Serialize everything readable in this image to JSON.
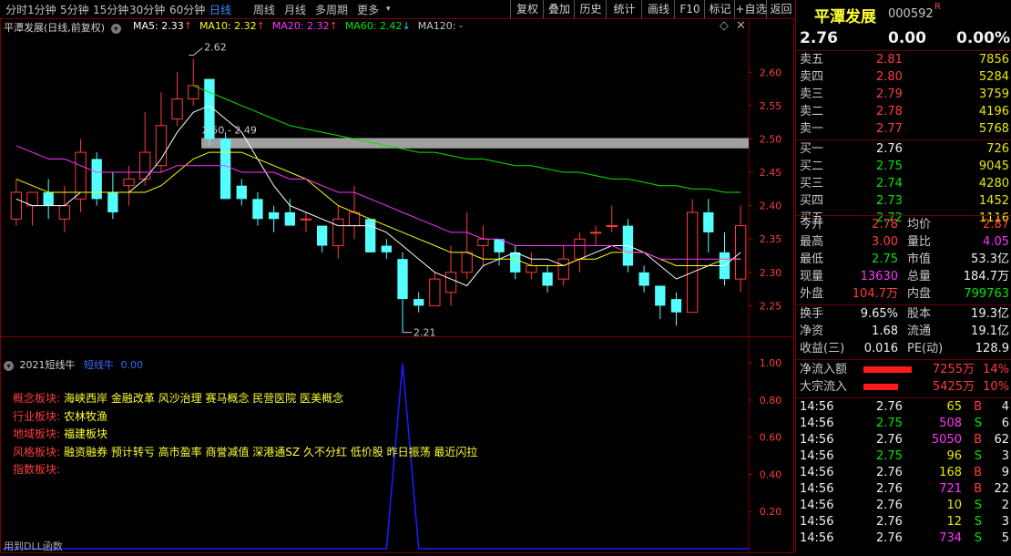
{
  "toolbar": {
    "periods": [
      "分时",
      "1分钟",
      "5分钟",
      "15分钟",
      "30分钟",
      "60分钟",
      "日线",
      "周线",
      "月线",
      "多周期",
      "更多"
    ],
    "active_period": "日线",
    "buttons": [
      "复权",
      "叠加",
      "历史",
      "统计",
      "画线",
      "F10",
      "标记",
      "+自选",
      "返回"
    ]
  },
  "main_chart": {
    "title": "平潭发展(日线,前复权)",
    "ma": [
      {
        "label": "MA5: 2.33",
        "arrow": "↑",
        "color": "#ffffff"
      },
      {
        "label": "MA10: 2.32",
        "arrow": "↑",
        "color": "#ffff00"
      },
      {
        "label": "MA20: 2.32",
        "arrow": "↑",
        "color": "#ff33ff"
      },
      {
        "label": "MA60: 2.42",
        "arrow": "↓",
        "color": "#00e600"
      },
      {
        "label": "MA120: -",
        "arrow": "",
        "color": "#c8c8c8"
      }
    ],
    "annotations": {
      "high": "2.62",
      "low": "2.21",
      "range": "2.50 - 2.49"
    },
    "y_ticks": [
      "2.60",
      "2.55",
      "2.50",
      "2.45",
      "2.40",
      "2.35",
      "2.30",
      "2.25"
    ]
  },
  "chart_data": {
    "type": "candlestick",
    "ylim": [
      2.2,
      2.64
    ],
    "candles": [
      {
        "o": 2.38,
        "h": 2.44,
        "l": 2.37,
        "c": 2.42
      },
      {
        "o": 2.4,
        "h": 2.42,
        "l": 2.37,
        "c": 2.42
      },
      {
        "o": 2.42,
        "h": 2.44,
        "l": 2.38,
        "c": 2.4
      },
      {
        "o": 2.38,
        "h": 2.43,
        "l": 2.36,
        "c": 2.4
      },
      {
        "o": 2.41,
        "h": 2.5,
        "l": 2.39,
        "c": 2.48
      },
      {
        "o": 2.47,
        "h": 2.48,
        "l": 2.4,
        "c": 2.41
      },
      {
        "o": 2.42,
        "h": 2.45,
        "l": 2.38,
        "c": 2.39
      },
      {
        "o": 2.43,
        "h": 2.46,
        "l": 2.4,
        "c": 2.44
      },
      {
        "o": 2.44,
        "h": 2.54,
        "l": 2.43,
        "c": 2.48
      },
      {
        "o": 2.46,
        "h": 2.57,
        "l": 2.45,
        "c": 2.52
      },
      {
        "o": 2.53,
        "h": 2.6,
        "l": 2.52,
        "c": 2.56
      },
      {
        "o": 2.56,
        "h": 2.62,
        "l": 2.55,
        "c": 2.58
      },
      {
        "o": 2.59,
        "h": 2.59,
        "l": 2.49,
        "c": 2.5
      },
      {
        "o": 2.5,
        "h": 2.51,
        "l": 2.41,
        "c": 2.41
      },
      {
        "o": 2.43,
        "h": 2.44,
        "l": 2.4,
        "c": 2.41
      },
      {
        "o": 2.41,
        "h": 2.42,
        "l": 2.37,
        "c": 2.38
      },
      {
        "o": 2.39,
        "h": 2.4,
        "l": 2.36,
        "c": 2.38
      },
      {
        "o": 2.39,
        "h": 2.41,
        "l": 2.38,
        "c": 2.37
      },
      {
        "o": 2.38,
        "h": 2.39,
        "l": 2.36,
        "c": 2.38
      },
      {
        "o": 2.37,
        "h": 2.37,
        "l": 2.33,
        "c": 2.34
      },
      {
        "o": 2.34,
        "h": 2.4,
        "l": 2.32,
        "c": 2.38
      },
      {
        "o": 2.37,
        "h": 2.43,
        "l": 2.35,
        "c": 2.39
      },
      {
        "o": 2.38,
        "h": 2.38,
        "l": 2.33,
        "c": 2.33
      },
      {
        "o": 2.34,
        "h": 2.35,
        "l": 2.32,
        "c": 2.33
      },
      {
        "o": 2.32,
        "h": 2.33,
        "l": 2.21,
        "c": 2.26
      },
      {
        "o": 2.26,
        "h": 2.27,
        "l": 2.24,
        "c": 2.25
      },
      {
        "o": 2.25,
        "h": 2.3,
        "l": 2.25,
        "c": 2.29
      },
      {
        "o": 2.27,
        "h": 2.34,
        "l": 2.25,
        "c": 2.3
      },
      {
        "o": 2.3,
        "h": 2.39,
        "l": 2.29,
        "c": 2.33
      },
      {
        "o": 2.34,
        "h": 2.37,
        "l": 2.31,
        "c": 2.35
      },
      {
        "o": 2.35,
        "h": 2.35,
        "l": 2.31,
        "c": 2.33
      },
      {
        "o": 2.33,
        "h": 2.34,
        "l": 2.29,
        "c": 2.3
      },
      {
        "o": 2.3,
        "h": 2.33,
        "l": 2.29,
        "c": 2.31
      },
      {
        "o": 2.3,
        "h": 2.31,
        "l": 2.27,
        "c": 2.28
      },
      {
        "o": 2.29,
        "h": 2.34,
        "l": 2.28,
        "c": 2.32
      },
      {
        "o": 2.32,
        "h": 2.36,
        "l": 2.3,
        "c": 2.35
      },
      {
        "o": 2.36,
        "h": 2.37,
        "l": 2.34,
        "c": 2.36
      },
      {
        "o": 2.37,
        "h": 2.4,
        "l": 2.36,
        "c": 2.37
      },
      {
        "o": 2.37,
        "h": 2.38,
        "l": 2.3,
        "c": 2.31
      },
      {
        "o": 2.3,
        "h": 2.31,
        "l": 2.27,
        "c": 2.28
      },
      {
        "o": 2.28,
        "h": 2.28,
        "l": 2.23,
        "c": 2.25
      },
      {
        "o": 2.26,
        "h": 2.27,
        "l": 2.22,
        "c": 2.24
      },
      {
        "o": 2.24,
        "h": 2.41,
        "l": 2.24,
        "c": 2.39
      },
      {
        "o": 2.39,
        "h": 2.41,
        "l": 2.33,
        "c": 2.36
      },
      {
        "o": 2.33,
        "h": 2.36,
        "l": 2.28,
        "c": 2.29
      },
      {
        "o": 2.29,
        "h": 2.4,
        "l": 2.27,
        "c": 2.37
      }
    ],
    "series": [
      {
        "name": "MA5",
        "color": "#ffffff",
        "values": [
          2.41,
          2.4,
          2.4,
          2.4,
          2.42,
          2.42,
          2.42,
          2.42,
          2.44,
          2.47,
          2.51,
          2.54,
          2.55,
          2.53,
          2.51,
          2.47,
          2.43,
          2.4,
          2.39,
          2.38,
          2.37,
          2.37,
          2.37,
          2.36,
          2.34,
          2.32,
          2.3,
          2.29,
          2.28,
          2.31,
          2.32,
          2.33,
          2.32,
          2.32,
          2.31,
          2.32,
          2.33,
          2.34,
          2.34,
          2.33,
          2.31,
          2.29,
          2.3,
          2.31,
          2.31,
          2.33
        ]
      },
      {
        "name": "MA10",
        "color": "#ffff00",
        "values": [
          2.44,
          2.43,
          2.42,
          2.42,
          2.42,
          2.42,
          2.42,
          2.42,
          2.42,
          2.43,
          2.45,
          2.47,
          2.48,
          2.48,
          2.48,
          2.47,
          2.46,
          2.45,
          2.44,
          2.42,
          2.4,
          2.39,
          2.38,
          2.37,
          2.36,
          2.35,
          2.34,
          2.33,
          2.33,
          2.32,
          2.32,
          2.32,
          2.31,
          2.31,
          2.31,
          2.32,
          2.32,
          2.33,
          2.33,
          2.33,
          2.32,
          2.31,
          2.31,
          2.31,
          2.32,
          2.32
        ]
      },
      {
        "name": "MA20",
        "color": "#ff33ff",
        "values": [
          2.49,
          2.48,
          2.47,
          2.47,
          2.46,
          2.45,
          2.45,
          2.45,
          2.45,
          2.45,
          2.46,
          2.46,
          2.46,
          2.46,
          2.45,
          2.45,
          2.45,
          2.44,
          2.44,
          2.43,
          2.42,
          2.42,
          2.41,
          2.4,
          2.39,
          2.38,
          2.37,
          2.36,
          2.36,
          2.35,
          2.35,
          2.34,
          2.34,
          2.34,
          2.34,
          2.34,
          2.34,
          2.34,
          2.33,
          2.33,
          2.32,
          2.32,
          2.32,
          2.32,
          2.32,
          2.32
        ]
      },
      {
        "name": "MA60",
        "color": "#00e600",
        "values": [
          null,
          null,
          null,
          null,
          null,
          null,
          null,
          null,
          null,
          null,
          null,
          2.58,
          2.57,
          2.56,
          2.55,
          2.54,
          2.53,
          2.52,
          2.515,
          2.51,
          2.505,
          2.5,
          2.495,
          2.49,
          2.485,
          2.48,
          2.48,
          2.475,
          2.47,
          2.47,
          2.465,
          2.46,
          2.46,
          2.455,
          2.45,
          2.45,
          2.445,
          2.44,
          2.44,
          2.435,
          2.43,
          2.43,
          2.425,
          2.425,
          2.42,
          2.42
        ]
      }
    ],
    "highlight_band": {
      "from": 2.49,
      "to": 2.5
    }
  },
  "indicator": {
    "title": "2021短线牛",
    "series_label": "短线牛",
    "value": "0.00",
    "y_ticks": [
      "1.00",
      "0.80",
      "0.60",
      "0.40",
      "0.20"
    ],
    "footer": "用到DLL函数",
    "peak_index": 24,
    "ylim": [
      0,
      1.05
    ],
    "sectors": [
      {
        "label": "概念板块:",
        "value": "海峡西岸 金融改革 风沙治理 赛马概念 民营医院 医美概念"
      },
      {
        "label": "行业板块:",
        "value": "农林牧渔"
      },
      {
        "label": "地域板块:",
        "value": "福建板块"
      },
      {
        "label": "风格板块:",
        "value": "融资融券 预计转亏 高市盈率 商誉减值 深港通SZ 久不分红 低价股 昨日振荡 最近闪拉"
      },
      {
        "label": "指数板块:",
        "value": ""
      }
    ]
  },
  "quote": {
    "name": "平潭发展",
    "code": "000592",
    "badge": "R",
    "price": "2.76",
    "change": "0.00",
    "pct": "0.00%",
    "asks": [
      {
        "label": "卖五",
        "price": "2.81",
        "vol": "7856"
      },
      {
        "label": "卖四",
        "price": "2.80",
        "vol": "5284"
      },
      {
        "label": "卖三",
        "price": "2.79",
        "vol": "3759"
      },
      {
        "label": "卖二",
        "price": "2.78",
        "vol": "4196"
      },
      {
        "label": "卖一",
        "price": "2.77",
        "vol": "5768"
      }
    ],
    "bids": [
      {
        "label": "买一",
        "price": "2.76",
        "vol": "726"
      },
      {
        "label": "买二",
        "price": "2.75",
        "vol": "9045"
      },
      {
        "label": "买三",
        "price": "2.74",
        "vol": "4280"
      },
      {
        "label": "买四",
        "price": "2.73",
        "vol": "1452"
      },
      {
        "label": "买五",
        "price": "2.72",
        "vol": "1116"
      }
    ],
    "stats": [
      {
        "l1": "今开",
        "v1": "2.78",
        "c1": "red",
        "l2": "均价",
        "v2": "2.87",
        "c2": "red"
      },
      {
        "l1": "最高",
        "v1": "3.00",
        "c1": "red",
        "l2": "量比",
        "v2": "4.05",
        "c2": "magenta"
      },
      {
        "l1": "最低",
        "v1": "2.75",
        "c1": "green",
        "l2": "市值",
        "v2": "53.3亿",
        "c2": "white"
      },
      {
        "l1": "现量",
        "v1": "13630",
        "c1": "magenta",
        "l2": "总量",
        "v2": "184.7万",
        "c2": "white"
      },
      {
        "l1": "外盘",
        "v1": "104.7万",
        "c1": "red",
        "l2": "内盘",
        "v2": "799763",
        "c2": "green"
      }
    ],
    "stats2": [
      {
        "l1": "换手",
        "v1": "9.65%",
        "c1": "white",
        "l2": "股本",
        "v2": "19.3亿",
        "c2": "white"
      },
      {
        "l1": "净资",
        "v1": "1.68",
        "c1": "white",
        "l2": "流通",
        "v2": "19.1亿",
        "c2": "white"
      },
      {
        "l1": "收益(三)",
        "v1": "0.016",
        "c1": "white",
        "l2": "PE(动)",
        "v2": "128.9",
        "c2": "white"
      }
    ],
    "flows": [
      {
        "label": "净流入额",
        "amount": "7255万",
        "pct": "14%",
        "bar": 0.14
      },
      {
        "label": "大宗流入",
        "amount": "5425万",
        "pct": "10%",
        "bar": 0.1
      }
    ],
    "ticks": [
      {
        "t": "14:56",
        "p": "2.76",
        "pc": "white",
        "v": "65",
        "vc": "yellow",
        "d": "B",
        "dc": "red",
        "n": "4"
      },
      {
        "t": "14:56",
        "p": "2.75",
        "pc": "green",
        "v": "508",
        "vc": "magenta",
        "d": "S",
        "dc": "green",
        "n": "6"
      },
      {
        "t": "14:56",
        "p": "2.76",
        "pc": "white",
        "v": "5050",
        "vc": "magenta",
        "d": "B",
        "dc": "red",
        "n": "62"
      },
      {
        "t": "14:56",
        "p": "2.75",
        "pc": "green",
        "v": "96",
        "vc": "yellow",
        "d": "S",
        "dc": "green",
        "n": "3"
      },
      {
        "t": "14:56",
        "p": "2.76",
        "pc": "white",
        "v": "168",
        "vc": "yellow",
        "d": "B",
        "dc": "red",
        "n": "9"
      },
      {
        "t": "14:56",
        "p": "2.76",
        "pc": "white",
        "v": "721",
        "vc": "magenta",
        "d": "B",
        "dc": "red",
        "n": "22"
      },
      {
        "t": "14:56",
        "p": "2.76",
        "pc": "white",
        "v": "10",
        "vc": "yellow",
        "d": "S",
        "dc": "green",
        "n": "2"
      },
      {
        "t": "14:56",
        "p": "2.76",
        "pc": "white",
        "v": "12",
        "vc": "yellow",
        "d": "S",
        "dc": "green",
        "n": "3"
      },
      {
        "t": "14:56",
        "p": "2.76",
        "pc": "white",
        "v": "734",
        "vc": "magenta",
        "d": "S",
        "dc": "green",
        "n": "5"
      }
    ]
  }
}
